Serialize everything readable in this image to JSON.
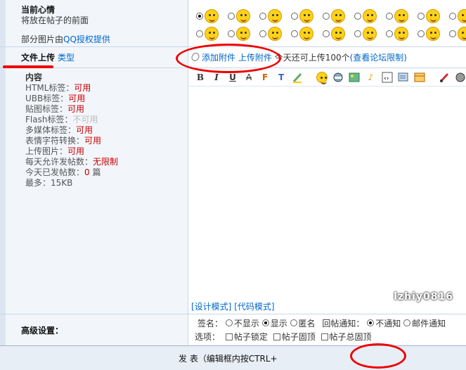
{
  "mood": {
    "title": "当前心情",
    "subtitle": "将放在帖子的前面",
    "qq_prefix": "部分图片由",
    "qq_link": "QQ授权提供"
  },
  "upload": {
    "title": "文件上传",
    "type_link": "类型",
    "add_attach": "添加附件",
    "upload_attach": "上传附件",
    "quota_text": "今天还可上传100个",
    "limit_link": "(查看论坛限制)"
  },
  "perms": {
    "header": "内容",
    "items": [
      {
        "label": "HTML标签：",
        "value": "可用",
        "ok": true
      },
      {
        "label": "UBB标签：",
        "value": "可用",
        "ok": true
      },
      {
        "label": "贴图标签：",
        "value": "可用",
        "ok": true
      },
      {
        "label": "Flash标签：",
        "value": "不可用",
        "ok": false
      },
      {
        "label": "多媒体标签：",
        "value": "可用",
        "ok": true
      },
      {
        "label": "表情字符转换：",
        "value": "可用",
        "ok": true
      },
      {
        "label": "上传图片：",
        "value": "可用",
        "ok": true
      },
      {
        "label": "每天允许发帖数：",
        "value": "无限制",
        "ok": true
      },
      {
        "label": "今天已发帖数：",
        "value": "0",
        "suffix": " 篇",
        "ok": true
      },
      {
        "label": "最多：",
        "value": "15KB",
        "ok": false
      }
    ]
  },
  "editor": {
    "design_mode": "[设计模式]",
    "code_mode": "[代码模式]",
    "watermark": "lzhiy0816"
  },
  "advanced": {
    "title": "高级设置：",
    "signature_label": "签名：",
    "sig_hide": "不显示",
    "sig_show": "显示",
    "sig_anon": "匿名",
    "reply_label": "回帖通知：",
    "reply_off": "不通知",
    "reply_mail": "邮件通知",
    "options_label": "选项：",
    "opt_lock": "帖子锁定",
    "opt_top": "帖子固顶",
    "opt_alltop": "帖子总固顶"
  },
  "submit": {
    "label": "发 表（编辑框内按CTRL+"
  }
}
